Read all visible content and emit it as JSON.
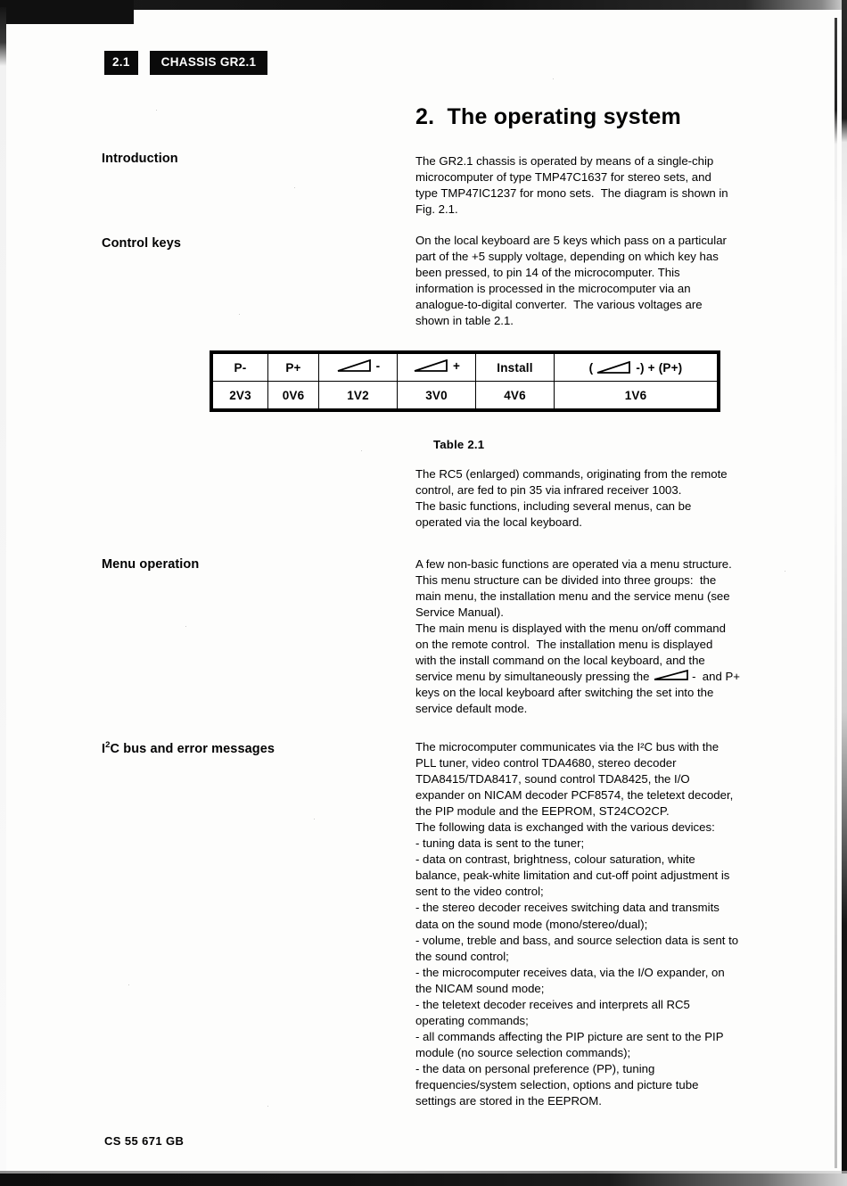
{
  "header": {
    "section_badge": "2.1",
    "chassis_badge": "CHASSIS GR2.1"
  },
  "title": "2.  The operating system",
  "sections": [
    {
      "heading": "Introduction",
      "body": "The GR2.1 chassis is operated by means of a single-chip\nmicrocomputer of type TMP47C1637 for stereo sets, and\ntype TMP47IC1237 for mono sets.  The diagram is shown in\nFig. 2.1."
    },
    {
      "heading": "Control keys",
      "body": "On the local keyboard are 5 keys which pass on a particular\npart of the +5 supply voltage, depending on which key has\nbeen pressed, to pin 14 of the microcomputer. This\ninformation is processed in the microcomputer via an\nanalogue-to-digital converter.  The various voltages are\nshown in table 2.1."
    }
  ],
  "table": {
    "caption": "Table 2.1",
    "columns": [
      {
        "label": "P-",
        "icon": null,
        "suffix": "",
        "prefix": "",
        "value": "2V3"
      },
      {
        "label": "P+",
        "icon": null,
        "suffix": "",
        "prefix": "",
        "value": "0V6"
      },
      {
        "label": "",
        "icon": "wedge-icon",
        "suffix": "-",
        "prefix": "",
        "value": "1V2"
      },
      {
        "label": "",
        "icon": "wedge-icon",
        "suffix": "+",
        "prefix": "",
        "value": "3V0"
      },
      {
        "label": "Install",
        "icon": null,
        "suffix": "",
        "prefix": "",
        "value": "4V6"
      },
      {
        "label": "",
        "icon": "wedge-icon",
        "suffix": "-) + (P+)",
        "prefix": "(",
        "value": "1V6"
      }
    ]
  },
  "after_table_body": "The RC5 (enlarged) commands, originating from the remote\ncontrol, are fed to pin 35 via infrared receiver 1003.\nThe basic functions, including several menus, can be\noperated via the local keyboard.",
  "menu_operation": {
    "heading": "Menu operation",
    "body_part1": "A few non-basic functions are operated via a menu structure.\nThis menu structure can be divided into three groups:  the\nmain menu, the installation menu and the service menu (see\nService Manual).\nThe main menu is displayed with the menu on/off command\non the remote control.  The installation menu is displayed\nwith the install command on the local keyboard, and the\nservice menu by simultaneously pressing the ",
    "inline_icon": "wedge-icon",
    "body_part2": "-  and P+\nkeys on the local keyboard after switching the set into the\nservice default mode."
  },
  "i2c": {
    "heading_pre": "I",
    "heading_sup": "2",
    "heading_post": "C bus and error messages",
    "body": "The microcomputer communicates via the I²C bus with the\nPLL tuner, video control TDA4680, stereo decoder\nTDA8415/TDA8417, sound control TDA8425, the I/O\nexpander on NICAM decoder PCF8574, the teletext decoder,\nthe PIP module and the EEPROM, ST24CO2CP.\nThe following data is exchanged with the various devices:\n- tuning data is sent to the tuner;\n- data on contrast, brightness, colour saturation, white\nbalance, peak-white limitation and cut-off point adjustment is\nsent to the video control;\n- the stereo decoder receives switching data and transmits\ndata on the sound mode (mono/stereo/dual);\n- volume, treble and bass, and source selection data is sent to\nthe sound control;\n- the microcomputer receives data, via the I/O expander, on\nthe NICAM sound mode;\n- the teletext decoder receives and interprets all RC5\noperating commands;\n- all commands affecting the PIP picture are sent to the PIP\nmodule (no source selection commands);\n- the data on personal preference (PP), tuning\nfrequencies/system selection, options and picture tube\nsettings are stored in the EEPROM."
  },
  "footer": "CS 55 671 GB",
  "colors": {
    "ink": "#000000",
    "paper": "#fdfdfc",
    "badge_bg": "#0a0a0a",
    "badge_text": "#ffffff"
  }
}
